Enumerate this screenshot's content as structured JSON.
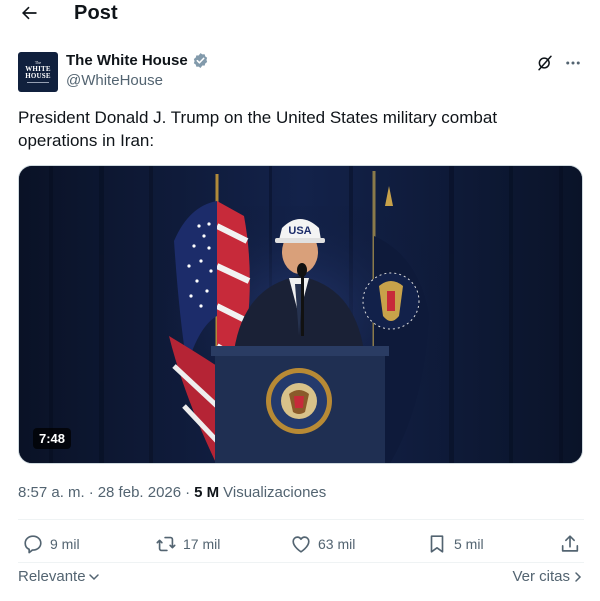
{
  "header": {
    "back_icon": "arrow-left-icon",
    "title": "Post"
  },
  "author": {
    "name": "The White House",
    "handle": "@WhiteHouse",
    "verified": true,
    "verified_color": "#829aab",
    "avatar": {
      "top_text": "The",
      "main_text_line1": "WHITE",
      "main_text_line2": "HOUSE",
      "background": "#10203d"
    }
  },
  "post": {
    "text": "President Donald J. Trump on the United States military combat operations in Iran:",
    "media": {
      "kind": "video",
      "duration": "7:48",
      "cap_text": "USA"
    }
  },
  "meta": {
    "time": "8:57 a. m.",
    "separator": "·",
    "date": "28 feb. 2026",
    "views_count": "5 M",
    "views_label": "Visualizaciones"
  },
  "actions": {
    "replies": "9 mil",
    "reposts": "17 mil",
    "likes": "63 mil",
    "bookmarks": "5 mil"
  },
  "footer": {
    "sort_label": "Relevante",
    "quotes_label": "Ver citas"
  },
  "colors": {
    "text": "#0f1419",
    "secondary": "#536471",
    "divider": "#eff3f4"
  }
}
